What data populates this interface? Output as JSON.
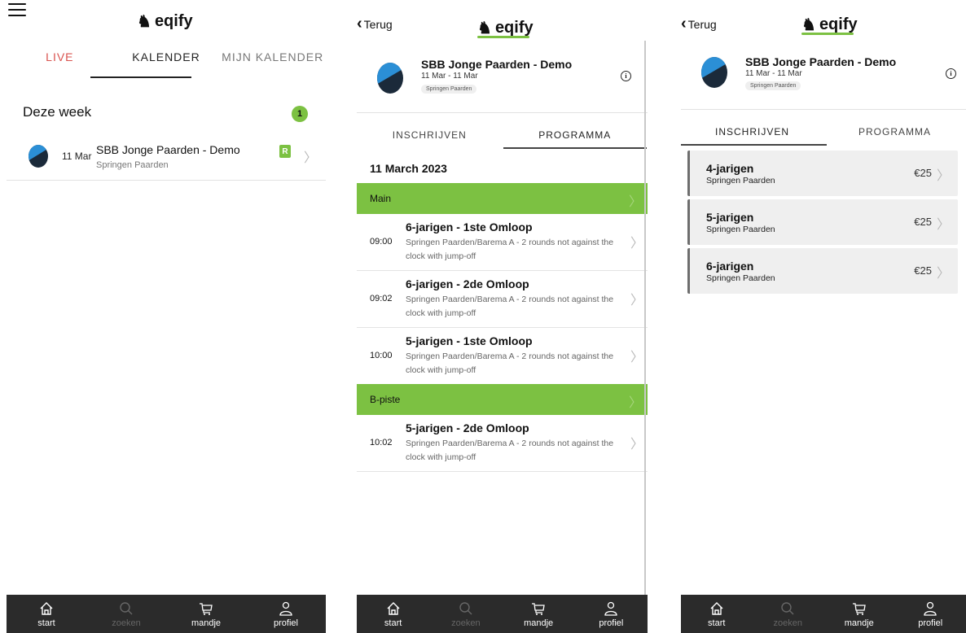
{
  "brand": {
    "logo_text": "eqify",
    "accent": "#7cc142",
    "live_color": "#d9534f",
    "tabbar_bg": "#2b2b2b"
  },
  "screen1": {
    "top_tabs": [
      "LIVE",
      "KALENDER",
      "MIJN KALENDER"
    ],
    "active_tab": "KALENDER",
    "section_title": "Deze week",
    "section_count": "1",
    "events": [
      {
        "date": "11 Mar",
        "name": "SBB Jonge Paarden - Demo",
        "discipline": "Springen Paarden",
        "badge": "R"
      }
    ]
  },
  "detail_common": {
    "back_label": "Terug",
    "event_title": "SBB Jonge Paarden - Demo",
    "event_dates": "11 Mar - 11 Mar",
    "event_tag": "Springen Paarden",
    "tabs": [
      "INSCHRIJVEN",
      "PROGRAMMA"
    ]
  },
  "screen2": {
    "active_tab": "PROGRAMMA",
    "program_date": "11 March 2023",
    "groups": [
      {
        "name": "Main",
        "items": [
          {
            "time": "09:00",
            "title": "6-jarigen - 1ste Omloop",
            "desc_a": "Springen Paarden",
            "desc_b": "Barema A - 2 rounds not against the clock with jump-off"
          },
          {
            "time": "09:02",
            "title": "6-jarigen - 2de Omloop",
            "desc_a": "Springen Paarden",
            "desc_b": "Barema A - 2 rounds not against the clock with jump-off"
          },
          {
            "time": "10:00",
            "title": "5-jarigen - 1ste Omloop",
            "desc_a": "Springen Paarden",
            "desc_b": "Barema A - 2 rounds not against the clock with jump-off"
          }
        ]
      },
      {
        "name": "B-piste",
        "items": [
          {
            "time": "10:02",
            "title": "5-jarigen - 2de Omloop",
            "desc_a": "Springen Paarden",
            "desc_b": "Barema A - 2 rounds not against the clock with jump-off"
          }
        ]
      }
    ]
  },
  "screen3": {
    "active_tab": "INSCHRIJVEN",
    "registrations": [
      {
        "name": "4-jarigen",
        "discipline": "Springen Paarden",
        "price": "€25"
      },
      {
        "name": "5-jarigen",
        "discipline": "Springen Paarden",
        "price": "€25"
      },
      {
        "name": "6-jarigen",
        "discipline": "Springen Paarden",
        "price": "€25"
      }
    ]
  },
  "bottom_nav": [
    {
      "label": "start",
      "icon": "home-icon",
      "active": true
    },
    {
      "label": "zoeken",
      "icon": "search-icon",
      "active": false
    },
    {
      "label": "mandje",
      "icon": "cart-icon",
      "active": true
    },
    {
      "label": "profiel",
      "icon": "profile-icon",
      "active": true
    }
  ]
}
